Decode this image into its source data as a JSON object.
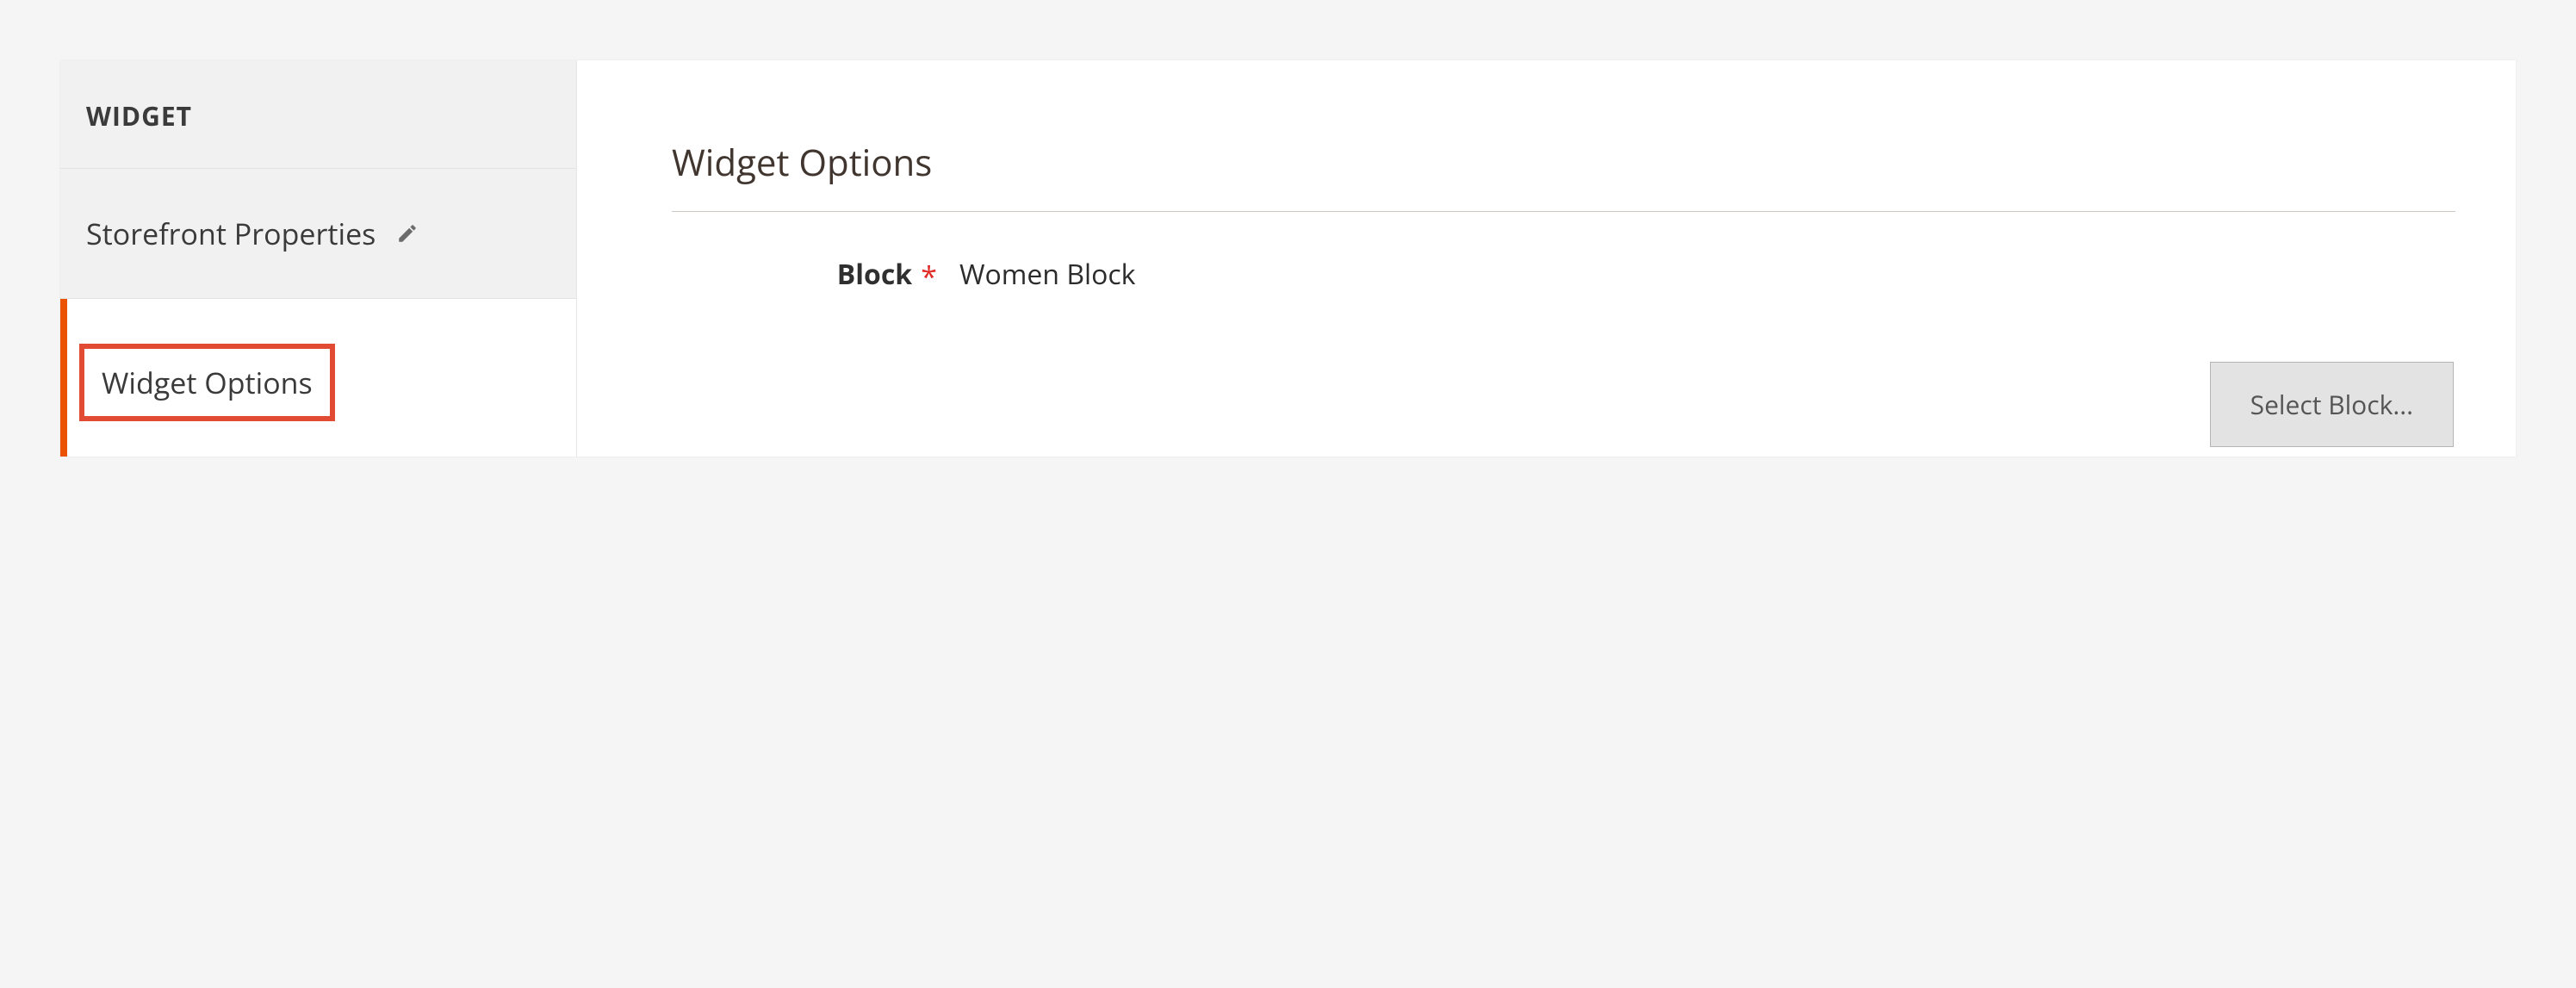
{
  "sidebar": {
    "header": "WIDGET",
    "tabs": [
      {
        "label": "Storefront Properties"
      },
      {
        "label": "Widget Options"
      }
    ]
  },
  "content": {
    "section_title": "Widget Options",
    "field_label": "Block",
    "required_mark": "*",
    "field_value": "Women Block",
    "select_block_button": "Select Block..."
  }
}
